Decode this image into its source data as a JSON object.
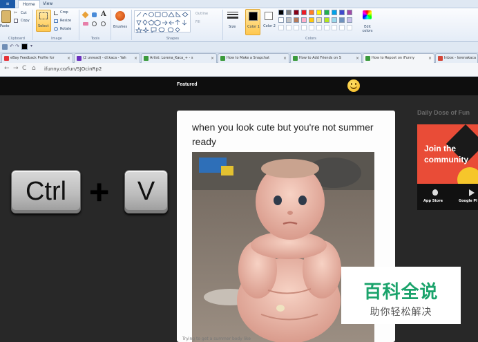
{
  "paint": {
    "tabs": {
      "file": "≡",
      "home": "Home",
      "view": "View"
    },
    "clipboard": {
      "paste": "Paste",
      "cut": "Cut",
      "copy": "Copy",
      "group": "Clipboard"
    },
    "image": {
      "select": "Select",
      "crop": "Crop",
      "resize": "Resize",
      "rotate": "Rotate",
      "group": "Image"
    },
    "tools": {
      "group": "Tools",
      "text_tool": "A"
    },
    "brushes": "Brushes",
    "shapes": {
      "outline": "Outline",
      "fill": "Fill",
      "group": "Shapes"
    },
    "size": "Size",
    "color1": "Color 1",
    "color2": "Color 2",
    "colors_group": "Colors",
    "edit_colors": "Edit colors",
    "palette": [
      "#000000",
      "#7f7f7f",
      "#880015",
      "#ed1c24",
      "#ff7f27",
      "#fff200",
      "#22b14c",
      "#00a2e8",
      "#3f48cc",
      "#a349a4",
      "#ffffff",
      "#c3c3c3",
      "#b97a57",
      "#ffaec9",
      "#ffc90e",
      "#efe4b0",
      "#b5e61d",
      "#99d9ea",
      "#7092be",
      "#c8bfe7"
    ],
    "accent": "#1c5aa8"
  },
  "browser": {
    "tabs": [
      {
        "label": "eBay Feedback Profile for",
        "color": "#e53238"
      },
      {
        "label": "(2 unread) - dl.kaca - Yah",
        "color": "#6b2fbe"
      },
      {
        "label": "Artist: Lorena_Kaca_+ - s",
        "color": "#3b9a3b"
      },
      {
        "label": "How to Make a Snapchat",
        "color": "#3b9a3b"
      },
      {
        "label": "How to Add Friends on S",
        "color": "#3b9a3b"
      },
      {
        "label": "How to Repost on iFunny",
        "color": "#3b9a3b"
      },
      {
        "label": "Inbox - lorenakaca",
        "color": "#d44638"
      }
    ],
    "url": "ifunny.co/fun/SJOcinRp2"
  },
  "site": {
    "nav_featured": "Featured",
    "keys": {
      "ctrl": "Ctrl",
      "plus": "+",
      "v": "V"
    },
    "post": {
      "caption": "when you look cute but you're not summer ready",
      "footer": "Trying to get a summer body like"
    },
    "sidebar": {
      "title": "Daily Dose of Fun",
      "ad_text": "Join the community",
      "app_store": "App Store",
      "google_play": "Google Pl"
    }
  },
  "watermark": {
    "title": "百科全说",
    "subtitle": "助你轻松解决"
  }
}
